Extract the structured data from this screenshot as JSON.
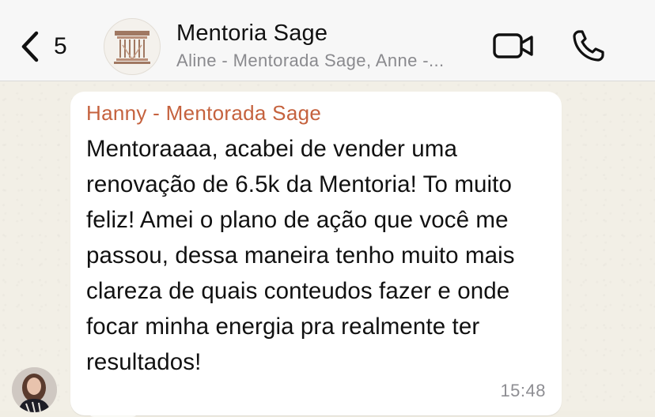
{
  "header": {
    "back_count": "5",
    "group_name": "Mentoria Sage",
    "members": "Aline - Mentorada Sage, Anne -...",
    "icons": {
      "back": "chevron-left-icon",
      "avatar": "column-logo-icon",
      "video": "video-camera-icon",
      "voice": "phone-icon"
    }
  },
  "message": {
    "sender": "Hanny - Mentorada Sage",
    "text": "Mentoraaaa, acabei de vender uma renovação de 6.5k da Mentoria! To muito feliz! Amei o plano de ação que você me passou, dessa maneira tenho muito mais clareza de quais conteudos fazer e onde focar minha energia pra realmente ter resultados!",
    "time": "15:48",
    "sender_color": "#c5623e"
  },
  "colors": {
    "header_bg": "#f7f7f7",
    "chat_bg": "#f2efe6",
    "bubble_bg": "#ffffff"
  }
}
